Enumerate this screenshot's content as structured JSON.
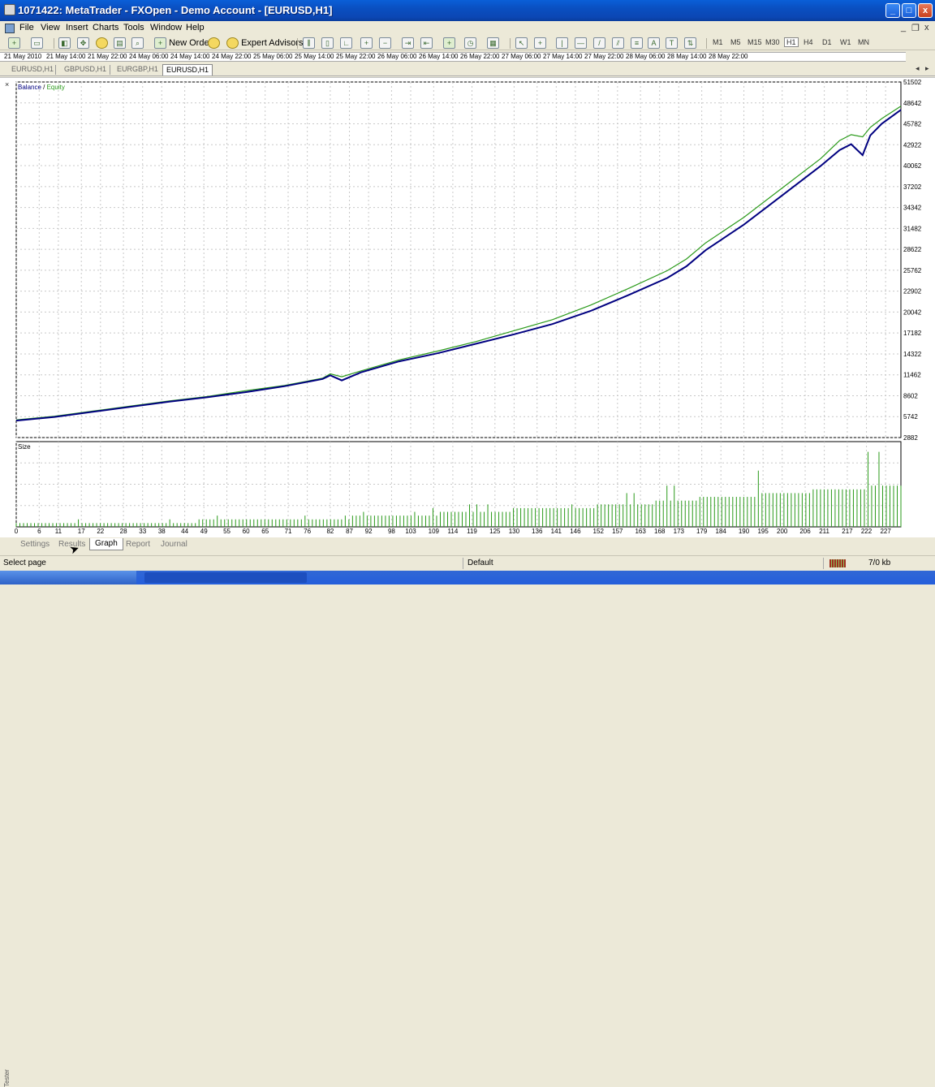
{
  "window": {
    "title": "1071422: MetaTrader - FXOpen - Demo Account - [EURUSD,H1]",
    "controls": {
      "minimize": "_",
      "maximize": "□",
      "close": "x"
    }
  },
  "menu": {
    "items": [
      "File",
      "View",
      "Insert",
      "Charts",
      "Tools",
      "Window",
      "Help"
    ],
    "mdi_controls": [
      "_",
      "❐",
      "x"
    ]
  },
  "toolbar": {
    "new_order_label": "New Order",
    "expert_advisors_label": "Expert Advisors",
    "timeframes": [
      "M1",
      "M5",
      "M15",
      "M30",
      "H1",
      "H4",
      "D1",
      "W1",
      "MN"
    ],
    "active_timeframe": "H1"
  },
  "time_axis": {
    "labels": [
      "21 May 2010",
      "21 May 14:00",
      "21 May 22:00",
      "24 May 06:00",
      "24 May 14:00",
      "24 May 22:00",
      "25 May 06:00",
      "25 May 14:00",
      "25 May 22:00",
      "26 May 06:00",
      "26 May 14:00",
      "26 May 22:00",
      "27 May 06:00",
      "27 May 14:00",
      "27 May 22:00",
      "28 May 06:00",
      "28 May 14:00",
      "28 May 22:00"
    ]
  },
  "chart_tabs": [
    {
      "label": "EURUSD,H1",
      "active": false
    },
    {
      "label": "GBPUSD,H1",
      "active": false
    },
    {
      "label": "EURGBP,H1",
      "active": false
    },
    {
      "label": "EURUSD,H1",
      "active": true
    }
  ],
  "chart_data": [
    {
      "type": "line",
      "title": "",
      "legend": [
        "Balance",
        "Equity"
      ],
      "legend_separator": "/",
      "legend_placement": "top-left",
      "grid": true,
      "ylim": [
        2882,
        51502
      ],
      "xlim": [
        0,
        231
      ],
      "y_ticks": [
        51502,
        48642,
        45782,
        42922,
        40062,
        37202,
        34342,
        31482,
        28622,
        25762,
        22902,
        20042,
        17182,
        14322,
        11462,
        8602,
        5742,
        2882
      ],
      "series": [
        {
          "name": "Balance",
          "color": "#000080",
          "x": [
            0,
            10,
            20,
            30,
            40,
            50,
            60,
            70,
            80,
            82,
            85,
            90,
            100,
            110,
            120,
            130,
            140,
            150,
            160,
            170,
            175,
            180,
            190,
            200,
            210,
            215,
            218,
            221,
            223,
            226,
            231
          ],
          "y": [
            5200,
            5700,
            6400,
            7100,
            7800,
            8400,
            9100,
            9900,
            10900,
            11400,
            10700,
            11800,
            13300,
            14400,
            15700,
            17000,
            18400,
            20200,
            22400,
            24700,
            26300,
            28500,
            32000,
            36000,
            40000,
            42200,
            43000,
            41500,
            44200,
            45800,
            47700
          ]
        },
        {
          "name": "Equity",
          "color": "#2a9a1a",
          "x": [
            0,
            10,
            20,
            30,
            40,
            50,
            60,
            70,
            80,
            82,
            85,
            90,
            100,
            110,
            120,
            130,
            140,
            150,
            160,
            170,
            175,
            180,
            190,
            200,
            210,
            215,
            218,
            221,
            223,
            226,
            231
          ],
          "y": [
            5300,
            5800,
            6500,
            7200,
            7900,
            8500,
            9300,
            10000,
            11000,
            11600,
            11200,
            12000,
            13500,
            14700,
            16000,
            17500,
            19000,
            21000,
            23300,
            25700,
            27300,
            29500,
            33000,
            37000,
            41000,
            43500,
            44300,
            44000,
            45300,
            46500,
            48200
          ]
        }
      ]
    },
    {
      "type": "bar",
      "title": "Size",
      "grid": true,
      "color": "#2a9a1a",
      "x_ticks": [
        0,
        6,
        11,
        17,
        22,
        28,
        33,
        38,
        44,
        49,
        55,
        60,
        65,
        71,
        76,
        82,
        87,
        92,
        98,
        103,
        109,
        114,
        119,
        125,
        130,
        136,
        141,
        146,
        152,
        157,
        163,
        168,
        173,
        179,
        184,
        190,
        195,
        200,
        206,
        211,
        217,
        222,
        227
      ],
      "values": [
        0.1,
        0.1,
        0.1,
        0.1,
        0.1,
        0.1,
        0.1,
        0.1,
        0.1,
        0.1,
        0.1,
        0.1,
        0.1,
        0.1,
        0.1,
        0.1,
        0.1,
        0.2,
        0.1,
        0.1,
        0.1,
        0.1,
        0.1,
        0.1,
        0.1,
        0.1,
        0.1,
        0.1,
        0.1,
        0.1,
        0.1,
        0.1,
        0.1,
        0.1,
        0.1,
        0.1,
        0.1,
        0.1,
        0.1,
        0.1,
        0.1,
        0.1,
        0.2,
        0.1,
        0.1,
        0.1,
        0.1,
        0.1,
        0.1,
        0.1,
        0.2,
        0.2,
        0.2,
        0.2,
        0.2,
        0.3,
        0.2,
        0.2,
        0.2,
        0.2,
        0.2,
        0.2,
        0.2,
        0.2,
        0.2,
        0.2,
        0.2,
        0.2,
        0.2,
        0.2,
        0.2,
        0.2,
        0.2,
        0.2,
        0.2,
        0.2,
        0.2,
        0.2,
        0.2,
        0.3,
        0.2,
        0.2,
        0.2,
        0.2,
        0.2,
        0.2,
        0.2,
        0.2,
        0.2,
        0.2,
        0.3,
        0.2,
        0.3,
        0.3,
        0.3,
        0.4,
        0.3,
        0.3,
        0.3,
        0.3,
        0.3,
        0.3,
        0.3,
        0.3,
        0.3,
        0.3,
        0.3,
        0.3,
        0.3,
        0.4,
        0.3,
        0.3,
        0.3,
        0.3,
        0.5,
        0.3,
        0.4,
        0.4,
        0.4,
        0.4,
        0.4,
        0.4,
        0.4,
        0.4,
        0.6,
        0.4,
        0.6,
        0.4,
        0.4,
        0.6,
        0.4,
        0.4,
        0.4,
        0.4,
        0.4,
        0.4,
        0.5,
        0.5,
        0.5,
        0.5,
        0.5,
        0.5,
        0.5,
        0.5,
        0.5,
        0.5,
        0.5,
        0.5,
        0.5,
        0.5,
        0.5,
        0.5,
        0.6,
        0.5,
        0.5,
        0.5,
        0.5,
        0.5,
        0.5,
        0.6,
        0.6,
        0.6,
        0.6,
        0.6,
        0.6,
        0.6,
        0.6,
        0.9,
        0.6,
        0.9,
        0.6,
        0.6,
        0.6,
        0.6,
        0.6,
        0.7,
        0.7,
        0.7,
        1.1,
        0.7,
        1.1,
        0.7,
        0.7,
        0.7,
        0.7,
        0.7,
        0.7,
        0.8,
        0.8,
        0.8,
        0.8,
        0.8,
        0.8,
        0.8,
        0.8,
        0.8,
        0.8,
        0.8,
        0.8,
        0.8,
        0.8,
        0.8,
        0.8,
        1.5,
        0.9,
        0.9,
        0.9,
        0.9,
        0.9,
        0.9,
        0.9,
        0.9,
        0.9,
        0.9,
        0.9,
        0.9,
        0.9,
        0.9,
        1.0,
        1.0,
        1.0,
        1.0,
        1.0,
        1.0,
        1.0,
        1.0,
        1.0,
        1.0,
        1.0,
        1.0,
        1.0,
        1.0,
        1.0,
        2.0,
        1.1,
        1.1,
        2.0,
        1.1,
        1.1,
        1.1,
        1.1,
        1.1,
        1.1
      ]
    }
  ],
  "tester_tabs": {
    "vertical_label": "Tester",
    "items": [
      "Settings",
      "Results",
      "Graph",
      "Report",
      "Journal"
    ],
    "active": "Graph"
  },
  "statusbar": {
    "help_text": "Select page",
    "profile": "Default",
    "traffic": "7/0 kb"
  }
}
